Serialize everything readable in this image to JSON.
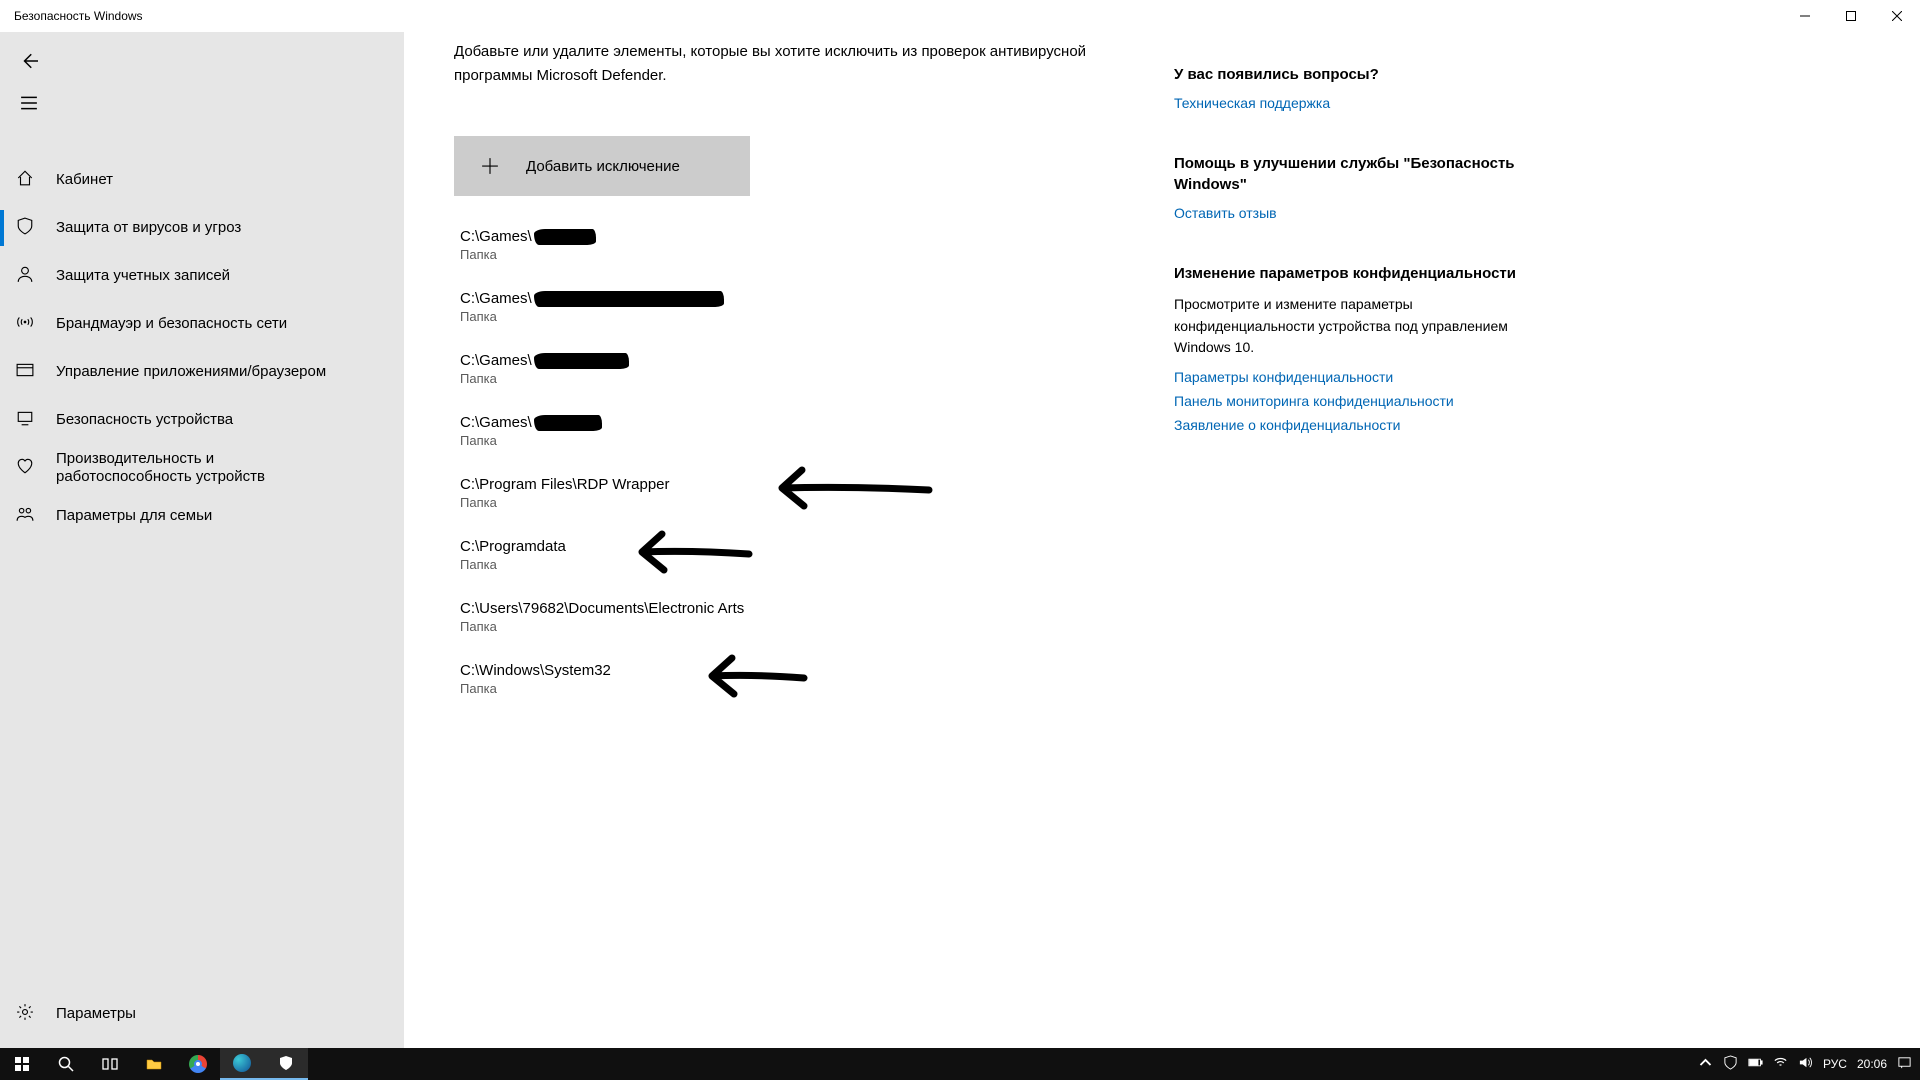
{
  "titlebar": {
    "title": "Безопасность Windows"
  },
  "sidebar": {
    "items": [
      {
        "label": "Кабинет"
      },
      {
        "label": "Защита от вирусов и угроз"
      },
      {
        "label": "Защита учетных записей"
      },
      {
        "label": "Брандмауэр и безопасность сети"
      },
      {
        "label": "Управление приложениями/браузером"
      },
      {
        "label": "Безопасность устройства"
      },
      {
        "label": "Производительность и работоспособность устройств"
      },
      {
        "label": "Параметры для семьи"
      }
    ],
    "settings_label": "Параметры"
  },
  "content": {
    "description": "Добавьте или удалите элементы, которые вы хотите исключить из проверок антивирусной программы Microsoft Defender.",
    "add_button": "Добавить исключение",
    "type_label": "Папка",
    "exclusions": [
      {
        "path_prefix": "C:\\Games\\",
        "redacted": true,
        "redact_width": 62
      },
      {
        "path_prefix": "C:\\Games\\",
        "redacted": true,
        "redact_width": 190
      },
      {
        "path_prefix": "C:\\Games\\",
        "redacted": true,
        "redact_width": 95
      },
      {
        "path_prefix": "C:\\Games\\",
        "redacted": true,
        "redact_width": 68
      },
      {
        "path_prefix": "C:\\Program Files\\RDP Wrapper",
        "redacted": false
      },
      {
        "path_prefix": "C:\\Programdata",
        "redacted": false
      },
      {
        "path_prefix": "C:\\Users\\79682\\Documents\\Electronic Arts",
        "redacted": false
      },
      {
        "path_prefix": "C:\\Windows\\System32",
        "redacted": false
      }
    ]
  },
  "right": {
    "q_heading": "У вас появились вопросы?",
    "q_link": "Техническая поддержка",
    "help_heading": "Помощь в улучшении службы \"Безопасность Windows\"",
    "help_link": "Оставить отзыв",
    "priv_heading": "Изменение параметров конфиденциальности",
    "priv_text": "Просмотрите и измените параметры конфиденциальности устройства под управлением Windows 10.",
    "priv_link1": "Параметры конфиденциальности",
    "priv_link2": "Панель мониторинга конфиденциальности",
    "priv_link3": "Заявление о конфиденциальности"
  },
  "taskbar": {
    "lang": "РУС",
    "time": "20:06"
  }
}
